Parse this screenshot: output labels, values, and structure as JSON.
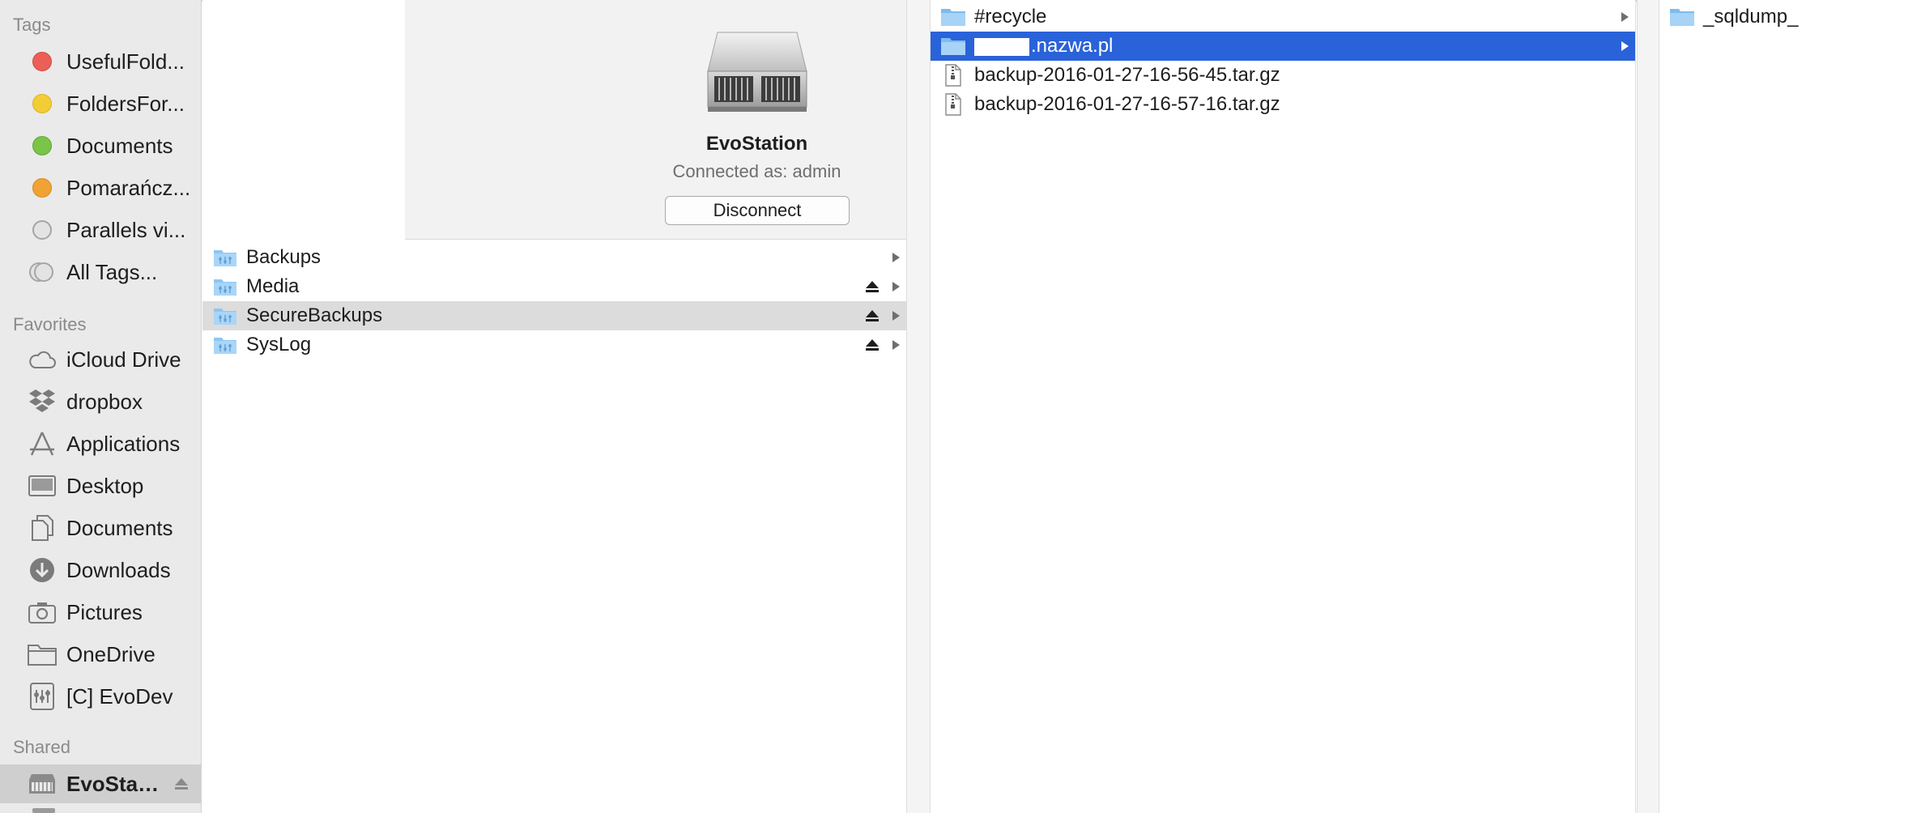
{
  "sidebar": {
    "tags_header": "Tags",
    "tags": [
      {
        "label": "UsefulFold...",
        "color": "#ec5f57"
      },
      {
        "label": "FoldersFor...",
        "color": "#f2cd36"
      },
      {
        "label": "Documents",
        "color": "#79c449"
      },
      {
        "label": "Pomarańcz...",
        "color": "#f0a334"
      },
      {
        "label": "Parallels vi...",
        "color": "#e3e3e3"
      },
      {
        "label": "All Tags...",
        "color": "#e3e3e3"
      }
    ],
    "favorites_header": "Favorites",
    "favorites": [
      {
        "label": "iCloud Drive",
        "icon": "cloud-icon"
      },
      {
        "label": "dropbox",
        "icon": "dropbox-icon"
      },
      {
        "label": "Applications",
        "icon": "applications-icon"
      },
      {
        "label": "Desktop",
        "icon": "desktop-icon"
      },
      {
        "label": "Documents",
        "icon": "documents-icon"
      },
      {
        "label": "Downloads",
        "icon": "downloads-icon"
      },
      {
        "label": "Pictures",
        "icon": "camera-icon"
      },
      {
        "label": "OneDrive",
        "icon": "folder-icon"
      },
      {
        "label": "[C] EvoDev",
        "icon": "network-volume-icon"
      }
    ],
    "shared_header": "Shared",
    "shared": [
      {
        "label": "EvoStati...",
        "icon": "server-icon"
      }
    ]
  },
  "server": {
    "name": "EvoStation",
    "connected_as": "Connected as: admin",
    "disconnect_label": "Disconnect"
  },
  "column1": {
    "items": [
      {
        "name": "Backups",
        "ejectable": false
      },
      {
        "name": "Media",
        "ejectable": true
      },
      {
        "name": "SecureBackups",
        "ejectable": true
      },
      {
        "name": "SysLog",
        "ejectable": true
      }
    ]
  },
  "column2": {
    "items": [
      {
        "name": "#recycle",
        "type": "folder"
      },
      {
        "name": ".nazwa.pl",
        "type": "folder"
      },
      {
        "name": "backup-2016-01-27-16-56-45.tar.gz",
        "type": "archive"
      },
      {
        "name": "backup-2016-01-27-16-57-16.tar.gz",
        "type": "archive"
      }
    ]
  },
  "column3": {
    "items": [
      {
        "name": "_sqldump_",
        "type": "folder"
      }
    ]
  },
  "colors": {
    "selection_blue": "#2a62d9",
    "selection_gray": "#dcdcdc",
    "folder_blue": "#8ec6f2"
  }
}
